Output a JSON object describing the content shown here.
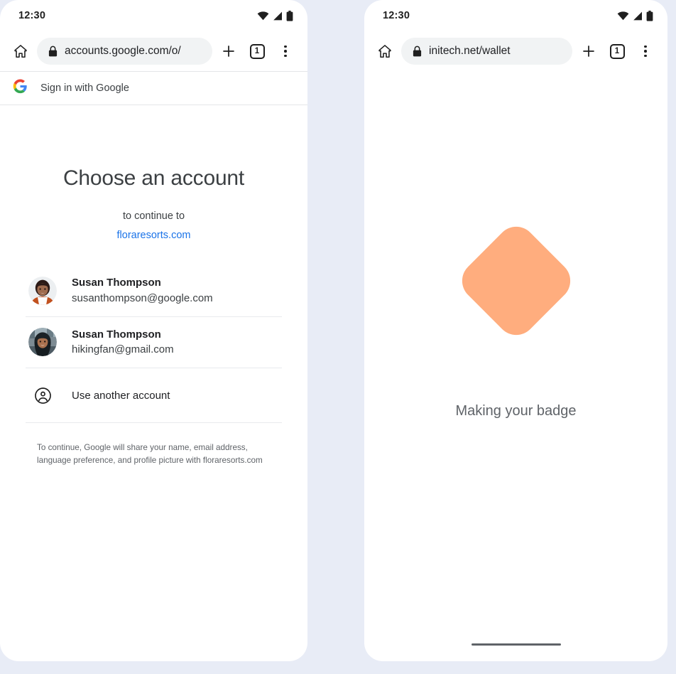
{
  "background_color": "#e8ecf6",
  "phones": {
    "left": {
      "status_bar": {
        "time": "12:30",
        "icons": [
          "wifi-icon",
          "signal-icon",
          "battery-icon"
        ]
      },
      "browser": {
        "home_icon": "home-icon",
        "lock_icon": "lock-icon",
        "url": "accounts.google.com/o/",
        "new_tab_icon": "plus-icon",
        "tab_count": "1",
        "menu_icon": "kebab-menu-icon"
      },
      "page": {
        "header": {
          "logo": "google-g-icon",
          "label": "Sign in with Google"
        },
        "title": "Choose an account",
        "subtitle": "to continue to",
        "domain": "floraresorts.com",
        "accounts": [
          {
            "avatar": "avatar-photo-susan-studio",
            "name": "Susan Thompson",
            "email": "susanthompson@google.com"
          },
          {
            "avatar": "avatar-photo-susan-outdoor",
            "name": "Susan Thompson",
            "email": "hikingfan@gmail.com"
          }
        ],
        "use_another_account": {
          "icon": "account-circle-icon",
          "label": "Use another account"
        },
        "consent_text": "To continue, Google will share your name, email address, language preference, and profile picture with floraresorts.com"
      }
    },
    "right": {
      "status_bar": {
        "time": "12:30",
        "icons": [
          "wifi-icon",
          "signal-icon",
          "battery-icon"
        ]
      },
      "browser": {
        "home_icon": "home-icon",
        "lock_icon": "lock-icon",
        "url": "initech.net/wallet",
        "new_tab_icon": "plus-icon",
        "tab_count": "1",
        "menu_icon": "kebab-menu-icon"
      },
      "page": {
        "badge_shape_color": "#ffad7e",
        "caption": "Making your badge",
        "home_indicator": true
      }
    }
  }
}
